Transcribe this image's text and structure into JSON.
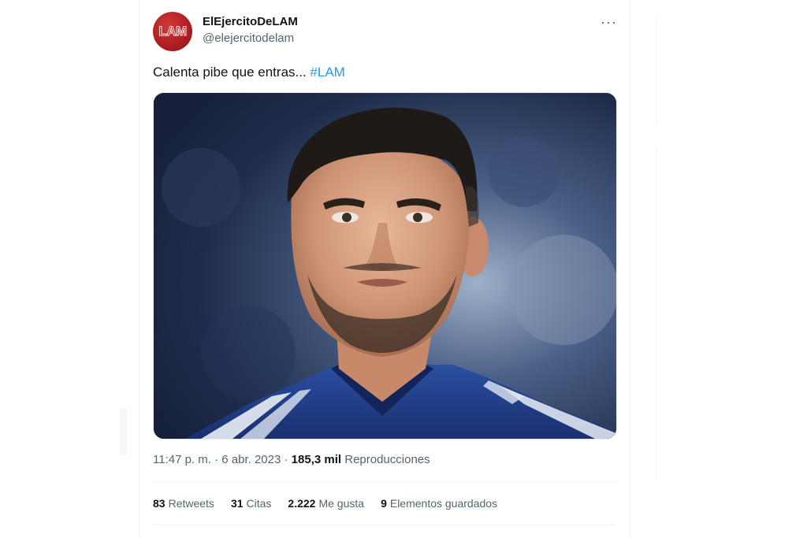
{
  "tweet": {
    "display_name": "ElEjercitoDeLAM",
    "handle": "@elejercitodelam",
    "avatar_text": "LAM",
    "more_label": "···",
    "text_main": "Calenta pibe que entras... ",
    "hashtag": "#LAM",
    "time": "11:47 p. m. · 6 abr. 2023 · ",
    "views_count": "185,3 mil",
    "views_label": "Reproducciones"
  },
  "stats": {
    "retweets_count": "83",
    "retweets_label": "Retweets",
    "quotes_count": "31",
    "quotes_label": "Citas",
    "likes_count": "2.222",
    "likes_label": "Me gusta",
    "bookmarks_count": "9",
    "bookmarks_label": "Elementos guardados"
  },
  "colors": {
    "accent": "#1d9bf0",
    "avatar": "#b01f22",
    "text_secondary": "#536471"
  }
}
